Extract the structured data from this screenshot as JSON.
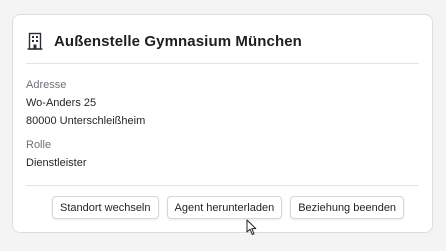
{
  "card": {
    "title": "Außenstelle Gymnasium München",
    "title_icon": "building-icon",
    "address_label": "Adresse",
    "street": "Wo-Anders 25",
    "city": "80000 Unterschleißheim",
    "role_label": "Rolle",
    "role_value": "Dienstleister"
  },
  "actions": {
    "switch_location": "Standort wechseln",
    "download_agent": "Agent herunterladen",
    "end_relationship": "Beziehung beenden"
  },
  "colors": {
    "background": "#f4f4f5",
    "card": "#ffffff",
    "border": "#dcdde1",
    "label_text": "#6b7078"
  }
}
